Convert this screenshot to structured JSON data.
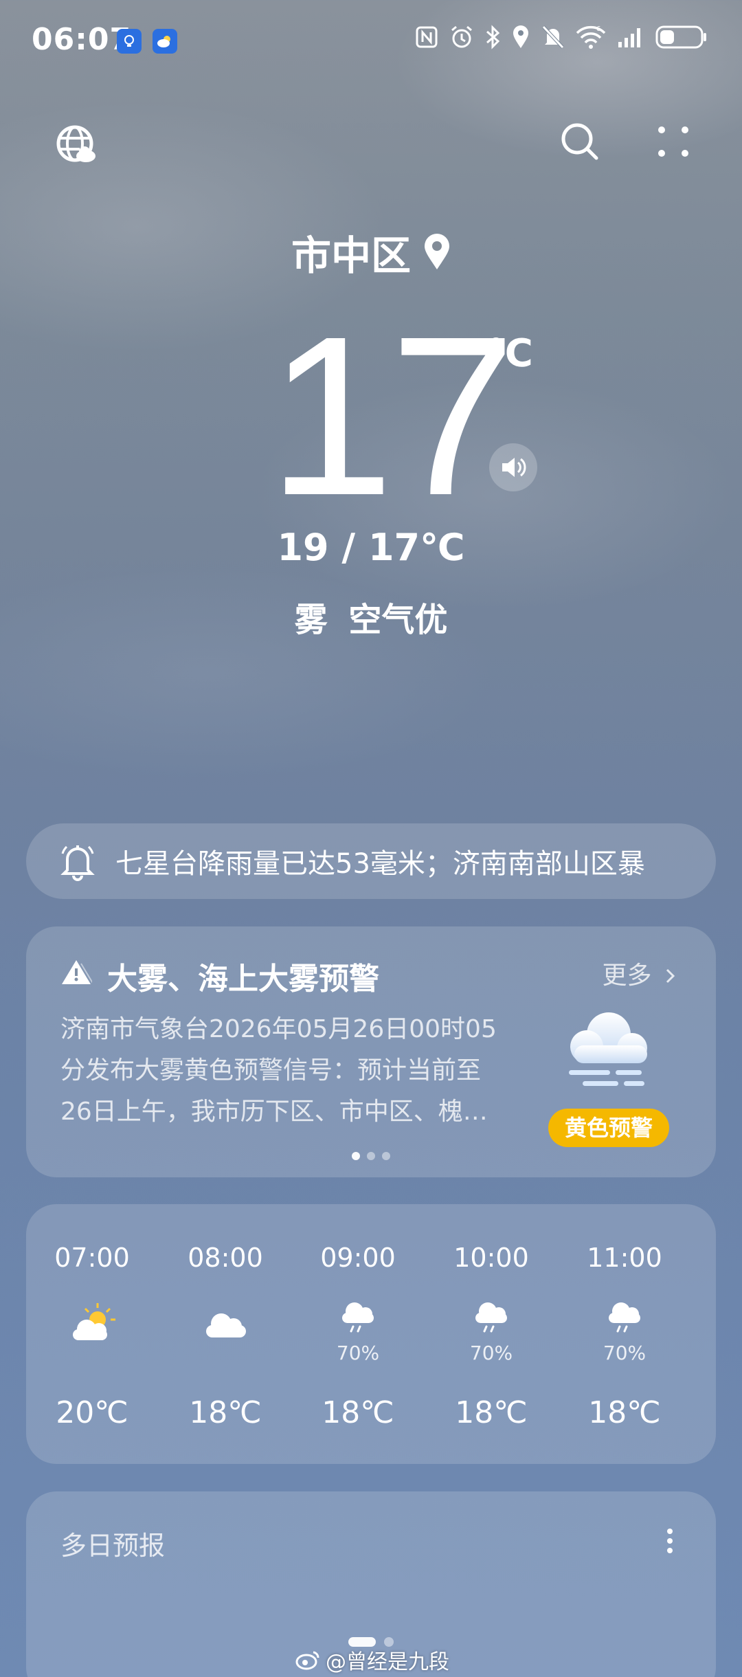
{
  "status_bar": {
    "time": "06:07",
    "battery_level": 0.35
  },
  "location": {
    "name": "市中区"
  },
  "current": {
    "temperature": "17",
    "unit": "℃",
    "range": "19 / 17℃",
    "condition": "雾  空气优"
  },
  "notice": {
    "text": "七星台降雨量已达53毫米；济南南部山区暴"
  },
  "alert": {
    "title": "大雾、海上大雾预警",
    "more_label": "更多",
    "body_lines": [
      "济南市气象台2026年05月26日00时05",
      "分发布大雾黄色预警信号：预计当前至",
      "26日上午，我市历下区、市中区、槐…"
    ],
    "badge_label": "黄色预警",
    "badge_color": "#f5b800",
    "page_count": 3,
    "page_active": 0
  },
  "hourly": [
    {
      "time": "07:00",
      "icon": "partly-sunny-icon",
      "pop": "",
      "temp": "20℃"
    },
    {
      "time": "08:00",
      "icon": "cloudy-icon",
      "pop": "",
      "temp": "18℃"
    },
    {
      "time": "09:00",
      "icon": "light-rain-icon",
      "pop": "70%",
      "temp": "18℃"
    },
    {
      "time": "10:00",
      "icon": "light-rain-icon",
      "pop": "70%",
      "temp": "18℃"
    },
    {
      "time": "11:00",
      "icon": "light-rain-icon",
      "pop": "70%",
      "temp": "18℃"
    }
  ],
  "daily": {
    "title": "多日预报"
  },
  "watermark": "@曾经是九段"
}
